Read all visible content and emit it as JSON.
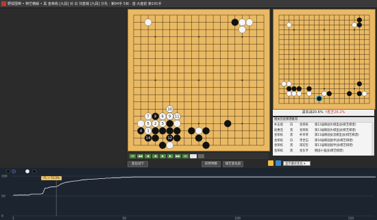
{
  "titlebar": {
    "title": "野狐围棋 • 棋艺精解 • 黑 金荣栋 [九段] 对 白 刘基锡 [九段]  分先 · 第94手 5目 · 首·大盘前   第191手"
  },
  "board": {
    "size": 19,
    "black": [
      [
        3,
        16
      ],
      [
        4,
        16
      ],
      [
        5,
        16
      ],
      [
        6,
        16
      ],
      [
        3,
        17
      ],
      [
        5,
        17
      ],
      [
        6,
        17
      ],
      [
        4,
        18
      ],
      [
        6,
        14
      ],
      [
        5,
        15
      ],
      [
        8,
        16
      ],
      [
        10,
        16
      ],
      [
        13,
        15
      ],
      [
        14,
        1
      ],
      [
        10,
        18
      ],
      [
        9,
        17
      ]
    ],
    "white": [
      [
        2,
        1
      ],
      [
        15,
        1
      ],
      [
        16,
        1
      ],
      [
        15,
        2
      ],
      [
        1,
        15
      ],
      [
        2,
        16
      ],
      [
        2,
        17
      ],
      [
        3,
        15
      ],
      [
        3,
        14
      ],
      [
        4,
        14
      ],
      [
        5,
        14
      ],
      [
        4,
        15
      ],
      [
        6,
        15
      ],
      [
        9,
        16
      ],
      [
        5,
        18
      ],
      [
        5,
        13
      ]
    ],
    "labels": [
      {
        "pt": [
          5,
          13
        ],
        "t": "10",
        "stone": "white"
      },
      {
        "pt": [
          2,
          14
        ],
        "t": "7",
        "stone": "white"
      },
      {
        "pt": [
          3,
          14
        ],
        "t": "8",
        "stone": "black"
      },
      {
        "pt": [
          4,
          14
        ],
        "t": "6",
        "stone": "white"
      },
      {
        "pt": [
          5,
          14
        ],
        "t": "9",
        "stone": "white"
      },
      {
        "pt": [
          6,
          14
        ],
        "t": "11",
        "stone": "white"
      },
      {
        "pt": [
          2,
          15
        ],
        "t": "5",
        "stone": "white"
      },
      {
        "pt": [
          3,
          15
        ],
        "t": "2",
        "stone": "white"
      },
      {
        "pt": [
          4,
          15
        ],
        "t": "3",
        "stone": "white"
      },
      {
        "pt": [
          1,
          16
        ],
        "t": "4",
        "stone": "black"
      },
      {
        "pt": [
          2,
          16
        ],
        "t": "1",
        "stone": "white"
      },
      {
        "pt": [
          2,
          17
        ],
        "t": "14",
        "stone": "black"
      },
      {
        "pt": [
          5,
          17
        ],
        "t": "12",
        "stone": "black"
      }
    ]
  },
  "nav": {
    "buttons": [
      "⏮",
      "◀◀",
      "◀",
      "◀",
      "▶",
      "▶",
      "▶▶",
      "⏭",
      "",
      ""
    ]
  },
  "buttons": {
    "try_play": "变化试下",
    "capture": "形势判断",
    "analysis": "棋艺变化前",
    "try_left": "试变化"
  },
  "preview": {
    "black": [
      [
        16,
        1
      ],
      [
        16,
        2
      ],
      [
        2,
        15
      ],
      [
        3,
        15
      ],
      [
        4,
        15
      ],
      [
        10,
        16
      ],
      [
        14,
        16
      ],
      [
        16,
        16
      ],
      [
        6,
        15
      ],
      [
        16,
        14
      ]
    ],
    "white": [
      [
        2,
        2
      ],
      [
        15,
        2
      ],
      [
        1,
        14
      ],
      [
        2,
        14
      ],
      [
        2,
        16
      ],
      [
        3,
        16
      ],
      [
        4,
        16
      ],
      [
        6,
        16
      ],
      [
        9,
        16
      ],
      [
        17,
        16
      ]
    ],
    "marker": [
      8,
      17
    ]
  },
  "score": {
    "prefix": "黑实战20.6%",
    "diff": "↑胜芝26.2%"
  },
  "list": {
    "header": "相关历史棋谱推荐",
    "rows": [
      [
        "朴志恩",
        "白",
        "金荣栋",
        "第12届韩国大棋圣战(棋艺棋谱)"
      ],
      [
        "赵惠连",
        "黑",
        "金荣栋",
        "第13届韩国大棋圣战(棋艺棋谱)"
      ],
      [
        "金荣栋",
        "黑",
        "朴宰贤",
        "第11届韩国女流棋圣战(棋艺棋谱)"
      ],
      [
        "金荣栋",
        "白",
        "李世石",
        "第18届韩国国手战(棋艺棋谱)"
      ],
      [
        "金荣栋",
        "黑",
        "宋宏哲",
        "第11届韩国国手战(棋艺棋谱)"
      ],
      [
        "金荣栋",
        "黑",
        "金东亨",
        "韩国十强战(棋艺棋谱)"
      ]
    ]
  },
  "select": {
    "value": "显示最优变化"
  },
  "graph": {
    "tooltip": "71 ~ 73.3%",
    "y_ticks": [
      "100",
      "50",
      "0"
    ],
    "x_ticks": [
      "1",
      "50",
      "100",
      "150"
    ],
    "winrate": [
      52,
      52,
      52,
      53,
      52,
      53,
      52,
      53,
      55,
      55,
      55,
      55,
      55,
      56,
      70,
      70,
      72,
      73,
      73,
      74,
      76,
      80,
      82,
      84,
      85,
      86,
      87,
      88,
      88,
      89,
      90,
      91,
      91,
      92,
      92,
      92,
      93,
      93,
      94,
      94,
      94,
      95,
      95,
      95,
      96,
      96,
      96,
      96,
      97,
      97,
      97,
      97,
      97,
      98,
      98,
      98,
      98,
      98,
      98,
      98,
      98,
      98,
      98,
      98,
      98,
      98,
      98,
      98,
      98,
      98,
      98,
      98,
      98,
      98,
      98,
      98,
      98,
      98,
      98,
      98,
      98,
      98,
      98,
      98,
      98,
      98,
      98,
      98,
      98,
      98,
      98,
      98,
      98,
      98,
      98,
      98,
      98,
      98,
      98,
      98,
      98,
      98,
      98,
      98,
      98,
      98,
      98,
      98,
      98,
      98,
      98,
      98,
      98,
      98,
      98,
      98,
      98,
      98,
      98,
      98,
      98,
      98,
      98,
      98,
      98,
      98,
      98,
      98,
      98,
      98,
      98,
      98,
      98,
      98,
      98,
      98,
      98,
      98,
      98,
      98,
      98,
      98,
      98,
      98,
      98,
      98,
      98,
      98,
      98,
      98,
      98,
      98,
      98,
      98,
      98,
      98,
      98,
      98,
      98,
      98,
      98
    ]
  },
  "colors": {
    "board": "#e9b964",
    "graph_bg": "#1c2430",
    "accent": "#4a8a3a"
  }
}
